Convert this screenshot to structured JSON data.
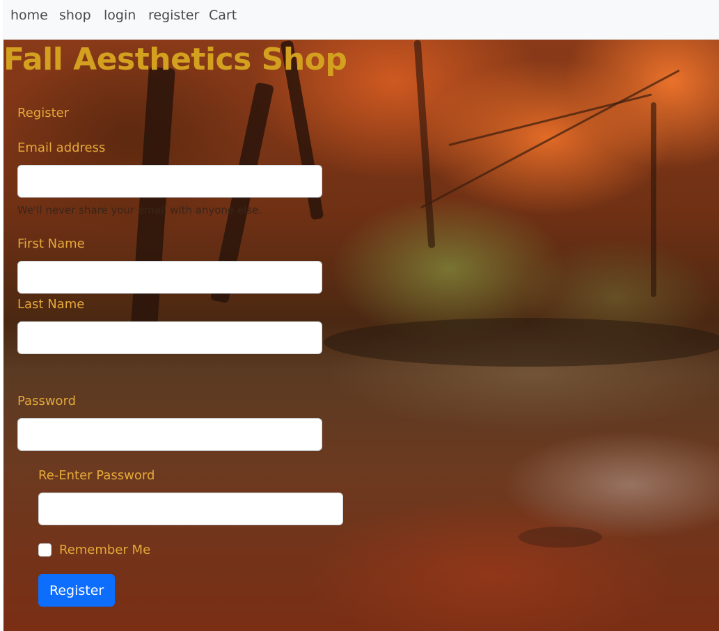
{
  "nav": {
    "items": [
      {
        "label": "home"
      },
      {
        "label": "shop"
      },
      {
        "label": "login"
      },
      {
        "label": "register"
      },
      {
        "label": "Cart"
      }
    ]
  },
  "header": {
    "title": "Fall Aesthetics Shop"
  },
  "form": {
    "heading": "Register",
    "email_label": "Email address",
    "email_value": "",
    "email_help": "We'll never share your email with anyone else.",
    "first_name_label": "First Name",
    "first_name_value": "",
    "last_name_label": "Last Name",
    "last_name_value": "",
    "password_label": "Password",
    "password_value": "",
    "reenter_password_label": "Re-Enter Password",
    "reenter_password_value": "",
    "remember_label": "Remember Me",
    "remember_checked": false,
    "submit_label": "Register"
  },
  "colors": {
    "title": "#d4a020",
    "label": "#e6a93a",
    "button": "#0d6efd",
    "navbar_bg": "#f8f9fa"
  }
}
